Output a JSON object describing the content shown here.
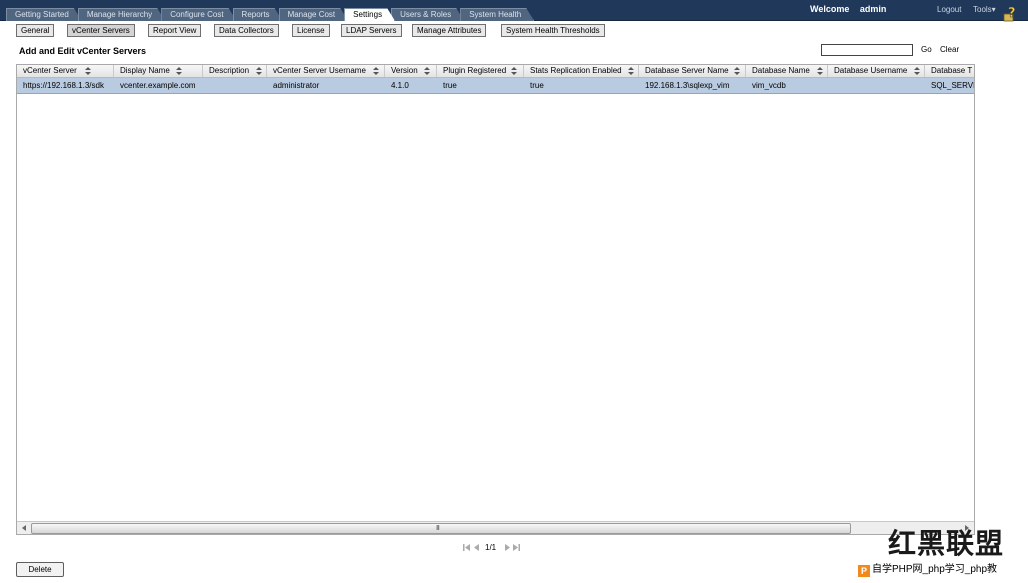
{
  "nav": {
    "tabs": [
      {
        "label": "Getting Started"
      },
      {
        "label": "Manage Hierarchy"
      },
      {
        "label": "Configure Cost"
      },
      {
        "label": "Reports"
      },
      {
        "label": "Manage Cost"
      },
      {
        "label": "Settings"
      },
      {
        "label": "Users & Roles"
      },
      {
        "label": "System Health"
      }
    ],
    "active_tab": "Settings"
  },
  "header": {
    "welcome_label": "Welcome",
    "username": "admin",
    "logout_label": "Logout",
    "tools_label": "Tools▾"
  },
  "subnav": {
    "buttons": [
      {
        "label": "General"
      },
      {
        "label": "vCenter Servers"
      },
      {
        "label": "Report View"
      },
      {
        "label": "Data Collectors"
      },
      {
        "label": "License"
      },
      {
        "label": "LDAP Servers"
      },
      {
        "label": "Manage Attributes"
      },
      {
        "label": "System Health Thresholds"
      }
    ],
    "active": "vCenter Servers"
  },
  "page": {
    "title": "Add and Edit vCenter Servers",
    "search": {
      "value": "",
      "placeholder": ""
    },
    "go_label": "Go",
    "clear_label": "Clear"
  },
  "grid": {
    "columns": [
      "vCenter Server",
      "Display Name",
      "Description",
      "vCenter Server Username",
      "Version",
      "Plugin Registered",
      "Stats Replication Enabled",
      "Database Server Name",
      "Database Name",
      "Database Username",
      "Database T"
    ],
    "rows": [
      [
        "https://192.168.1.3/sdk",
        "vcenter.example.com",
        "",
        "administrator",
        "4.1.0",
        "true",
        "true",
        "192.168.1.3\\sqlexp_vim",
        "vim_vcdb",
        "",
        "SQL_SERVEF"
      ]
    ],
    "scrollbar_grip": "III"
  },
  "pager": {
    "text": "1/1"
  },
  "footer": {
    "delete_label": "Delete"
  },
  "watermark": {
    "logo_text": "红黑联盟",
    "bar_icon": "P",
    "bar_text": "自学PHP网_php学习_php教"
  },
  "colors": {
    "topbar": "#20395a",
    "tab_inactive": "#4f6580",
    "selected_row": "#b9cbe0"
  }
}
